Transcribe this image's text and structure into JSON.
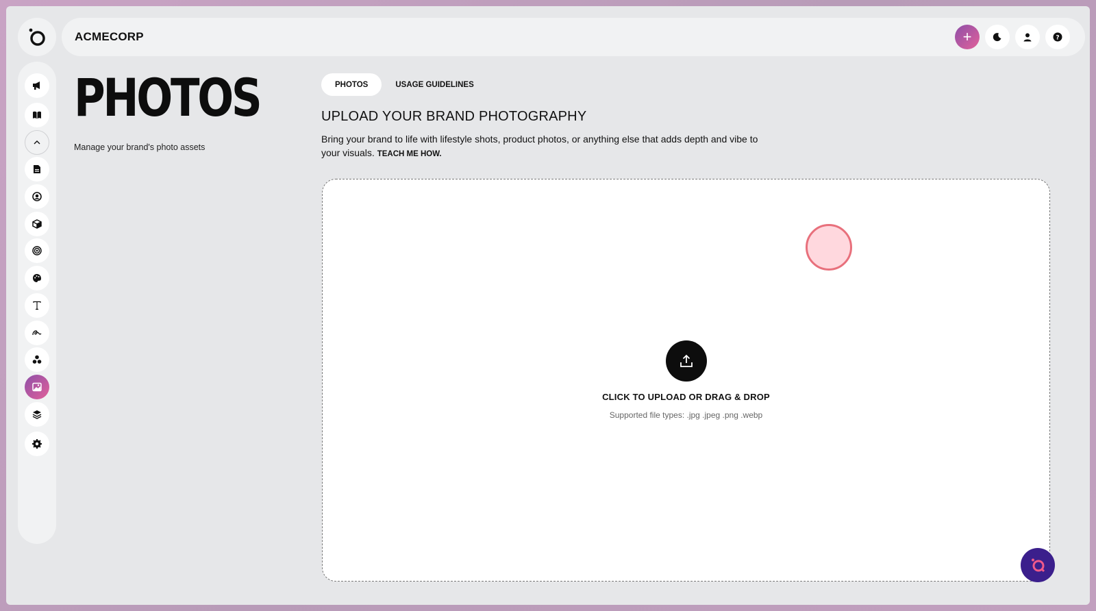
{
  "app": {
    "brand": "ACMECORP",
    "accent_gradient": [
      "#8e4fa8",
      "#e2619a"
    ]
  },
  "topbar": {
    "icons": [
      "plus-icon",
      "moon-icon",
      "user-icon",
      "help-icon"
    ],
    "add_label": "+"
  },
  "sidebar": {
    "items": [
      {
        "icon": "megaphone-icon"
      },
      {
        "icon": "book-icon"
      },
      {
        "icon": "chevron-up-icon"
      },
      {
        "icon": "document-icon"
      },
      {
        "icon": "face-icon"
      },
      {
        "icon": "cube-icon"
      },
      {
        "icon": "target-icon"
      },
      {
        "icon": "palette-icon"
      },
      {
        "icon": "type-icon"
      },
      {
        "icon": "signature-icon"
      },
      {
        "icon": "cluster-icon"
      },
      {
        "icon": "image-icon",
        "active": true
      },
      {
        "icon": "layers-icon"
      },
      {
        "icon": "gear-icon"
      }
    ]
  },
  "page": {
    "title": "PHOTOS",
    "subtitle": "Manage your brand's photo assets"
  },
  "tabs": [
    {
      "label": "PHOTOS",
      "active": true
    },
    {
      "label": "USAGE GUIDELINES",
      "active": false
    }
  ],
  "section": {
    "title": "UPLOAD YOUR BRAND PHOTOGRAPHY",
    "description": "Bring your brand to life with lifestyle shots, product photos, or anything else that adds depth and vibe to your visuals.",
    "link": "TEACH ME HOW."
  },
  "dropzone": {
    "label": "CLICK TO UPLOAD OR DRAG & DROP",
    "types": "Supported file types: .jpg .jpeg .png .webp"
  }
}
